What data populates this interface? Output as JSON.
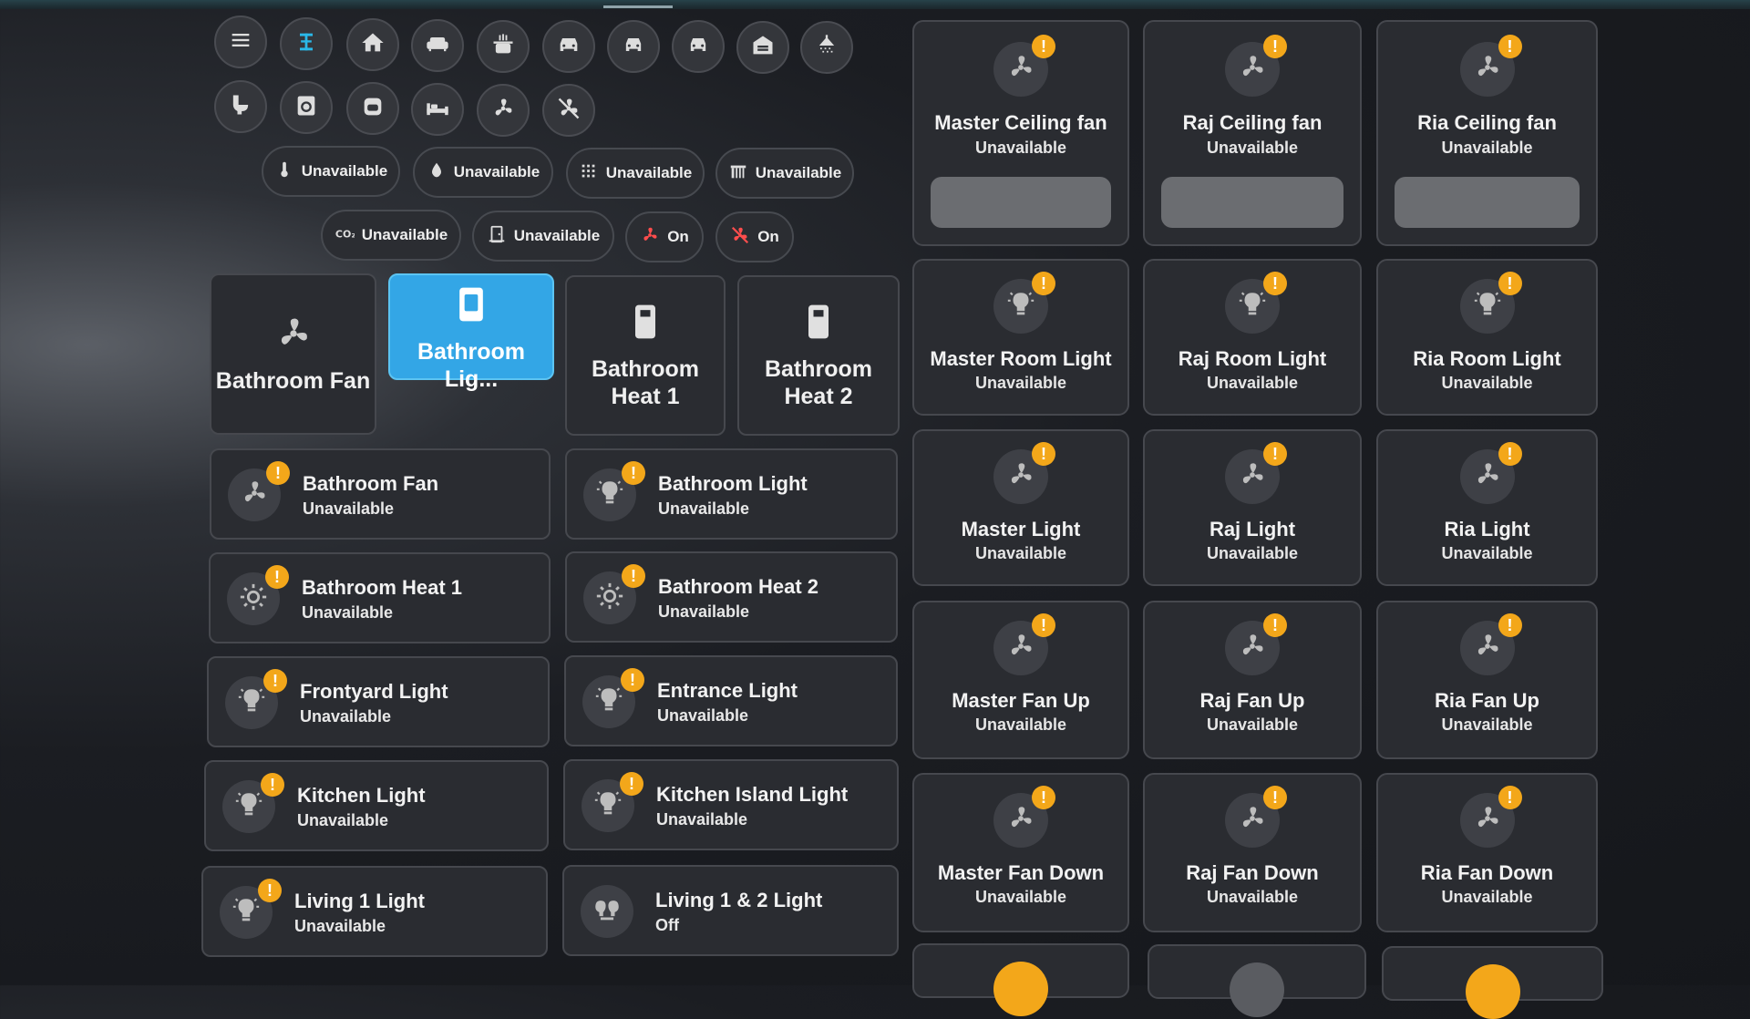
{
  "nav": {
    "row1": [
      {
        "icon": "menu-icon"
      },
      {
        "icon": "text-cursor-icon",
        "active": true
      },
      {
        "icon": "home-icon"
      },
      {
        "icon": "sofa-icon"
      },
      {
        "icon": "pot-icon"
      },
      {
        "icon": "car-icon"
      },
      {
        "icon": "car-icon"
      },
      {
        "icon": "car-icon"
      },
      {
        "icon": "garage-icon"
      },
      {
        "icon": "shower-icon"
      }
    ],
    "row2": [
      {
        "icon": "toilet-icon"
      },
      {
        "icon": "washer-icon"
      },
      {
        "icon": "dryer-icon"
      },
      {
        "icon": "bed-icon"
      },
      {
        "icon": "fan-icon"
      },
      {
        "icon": "fan-off-icon"
      }
    ]
  },
  "chips": [
    {
      "icon": "thermometer-icon",
      "label": "Unavailable"
    },
    {
      "icon": "water-drop-icon",
      "label": "Unavailable"
    },
    {
      "icon": "sensor-grid-icon",
      "label": "Unavailable"
    },
    {
      "icon": "radiator-icon",
      "label": "Unavailable"
    },
    {
      "icon": "co2-icon",
      "label": "Unavailable"
    },
    {
      "icon": "door-sensor-icon",
      "label": "Unavailable"
    },
    {
      "icon": "fan-icon",
      "label": "On",
      "accent": "#ff4d4d"
    },
    {
      "icon": "fan-off-icon",
      "label": "On",
      "accent": "#ff4d4d"
    }
  ],
  "tiles": [
    {
      "label": "Bathroom Fan",
      "icon": "fan-icon"
    },
    {
      "label": "Bathroom Lig...",
      "icon": "light-switch-icon",
      "active": true
    },
    {
      "label": "Bathroom Heat 1",
      "icon": "switch-icon"
    },
    {
      "label": "Bathroom Heat 2",
      "icon": "switch-icon"
    }
  ],
  "rows": [
    {
      "name": "Bathroom Fan",
      "state": "Unavailable",
      "icon": "fan-icon",
      "badge": "!"
    },
    {
      "name": "Bathroom Light",
      "state": "Unavailable",
      "icon": "bulb-icon",
      "badge": "!"
    },
    {
      "name": "Bathroom Heat 1",
      "state": "Unavailable",
      "icon": "heat-icon",
      "badge": "!"
    },
    {
      "name": "Bathroom Heat 2",
      "state": "Unavailable",
      "icon": "heat-icon",
      "badge": "!"
    },
    {
      "name": "Frontyard Light",
      "state": "Unavailable",
      "icon": "bulb-icon",
      "badge": "!"
    },
    {
      "name": "Entrance Light",
      "state": "Unavailable",
      "icon": "bulb-icon",
      "badge": "!"
    },
    {
      "name": "Kitchen Light",
      "state": "Unavailable",
      "icon": "bulb-icon",
      "badge": "!"
    },
    {
      "name": "Kitchen Island Light",
      "state": "Unavailable",
      "icon": "bulb-icon",
      "badge": "!"
    },
    {
      "name": "Living 1 Light",
      "state": "Unavailable",
      "icon": "bulb-icon",
      "badge": "!"
    },
    {
      "name": "Living 1 & 2 Light",
      "state": "Off",
      "icon": "lamp-group-icon",
      "badge": ""
    }
  ],
  "cards": [
    {
      "name": "Master Ceiling fan",
      "state": "Unavailable",
      "icon": "fan-icon",
      "badge": "!"
    },
    {
      "name": "Raj Ceiling fan",
      "state": "Unavailable",
      "icon": "fan-icon",
      "badge": "!"
    },
    {
      "name": "Ria Ceiling fan",
      "state": "Unavailable",
      "icon": "fan-icon",
      "badge": "!"
    },
    {
      "name": "Master Room Light",
      "state": "Unavailable",
      "icon": "bulb-icon",
      "badge": "!"
    },
    {
      "name": "Raj Room Light",
      "state": "Unavailable",
      "icon": "bulb-icon",
      "badge": "!"
    },
    {
      "name": "Ria Room Light",
      "state": "Unavailable",
      "icon": "bulb-icon",
      "badge": "!"
    },
    {
      "name": "Master Light",
      "state": "Unavailable",
      "icon": "fan-icon",
      "badge": "!"
    },
    {
      "name": "Raj Light",
      "state": "Unavailable",
      "icon": "fan-icon",
      "badge": "!"
    },
    {
      "name": "Ria Light",
      "state": "Unavailable",
      "icon": "fan-icon",
      "badge": "!"
    },
    {
      "name": "Master Fan Up",
      "state": "Unavailable",
      "icon": "fan-icon",
      "badge": "!"
    },
    {
      "name": "Raj Fan Up",
      "state": "Unavailable",
      "icon": "fan-icon",
      "badge": "!"
    },
    {
      "name": "Ria Fan Up",
      "state": "Unavailable",
      "icon": "fan-icon",
      "badge": "!"
    },
    {
      "name": "Master Fan Down",
      "state": "Unavailable",
      "icon": "fan-icon",
      "badge": "!"
    },
    {
      "name": "Raj Fan Down",
      "state": "Unavailable",
      "icon": "fan-icon",
      "badge": "!"
    },
    {
      "name": "Ria Fan Down",
      "state": "Unavailable",
      "icon": "fan-icon",
      "badge": "!"
    }
  ],
  "colors": {
    "accent": "#2ab8e8",
    "badge": "#f3a71a",
    "tile_active": "#33a6e6",
    "alert": "#ff4d4d"
  }
}
